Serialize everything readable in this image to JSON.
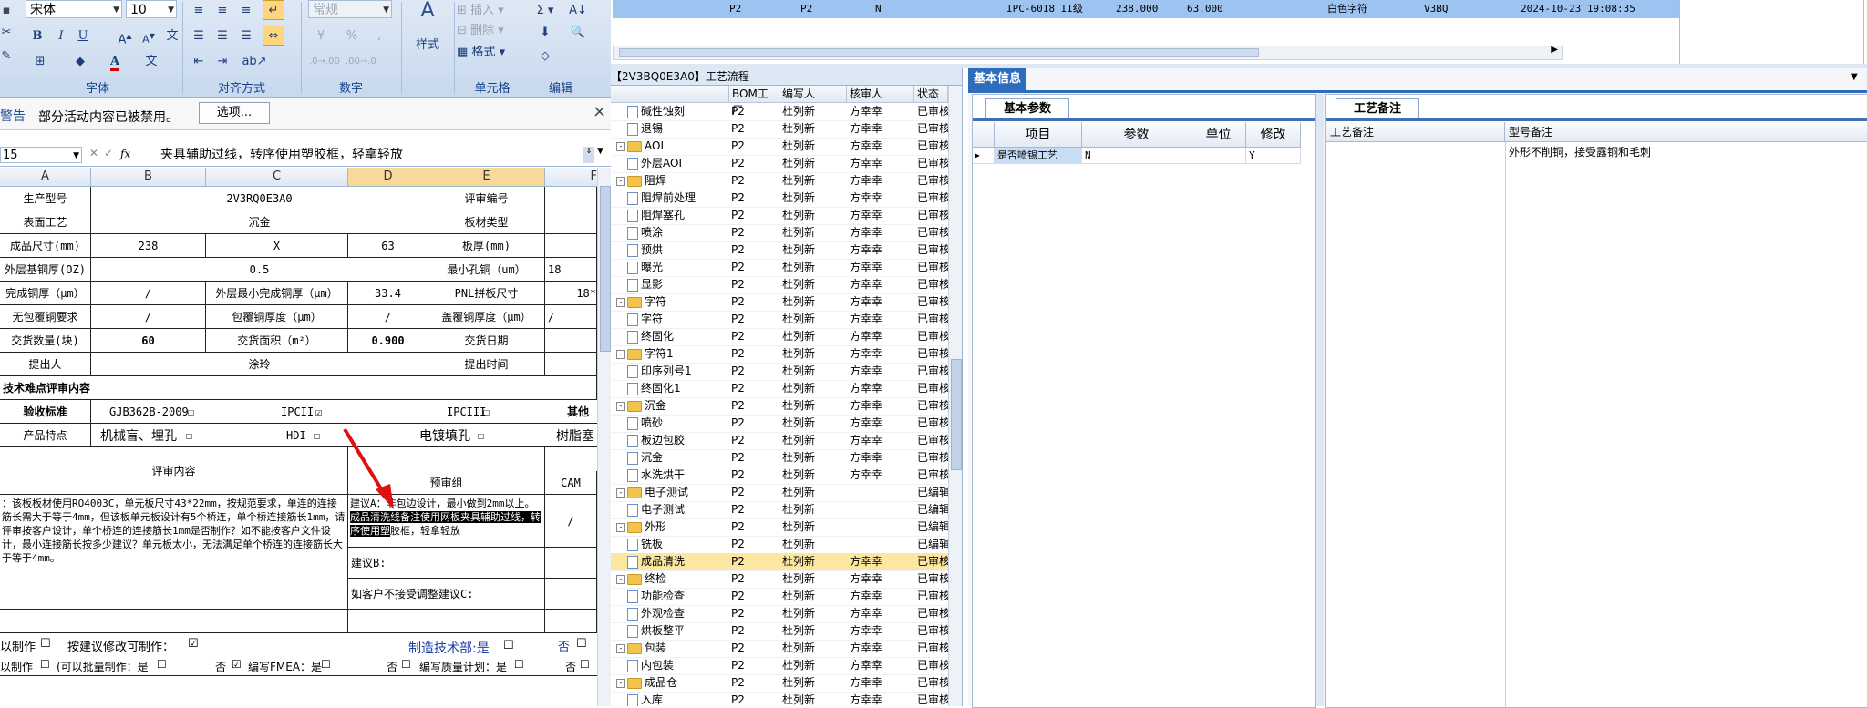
{
  "ribbon": {
    "font_name": "宋体",
    "font_size": "10",
    "number_format": "常规",
    "groups": [
      "字体",
      "对齐方式",
      "数字",
      "单元格",
      "编辑"
    ],
    "style_label": "样式",
    "insert_label": "插入",
    "delete_label": "删除",
    "format_label": "格式",
    "sigma": "Σ",
    "font_color": "#d40000"
  },
  "warning": {
    "title": "警告",
    "message": "部分活动内容已被禁用。",
    "options_button": "选项...",
    "close": "×"
  },
  "formula_bar": {
    "name_box": "15",
    "fx": "fx",
    "content": "夹具辅助过线，转序使用塑胶框，轻拿轻放"
  },
  "columns": [
    "A",
    "B",
    "C",
    "D",
    "E",
    "F"
  ],
  "sheet": {
    "r1": [
      "生产型号",
      "2V3RQ0E3A0",
      "评审编号",
      ""
    ],
    "r2": [
      "表面工艺",
      "沉金",
      "板材类型",
      ""
    ],
    "r3": [
      "成品尺寸(mm)",
      "238",
      "X",
      "63",
      "板厚(mm)",
      ""
    ],
    "r4": [
      "外层基铜厚(OZ)",
      "0.5",
      "最小孔铜（um）",
      "18"
    ],
    "r5": [
      "完成铜厚（μm）",
      "/",
      "外层最小完成铜厚（μm）",
      "33.4",
      "PNL拼板尺寸",
      "18*"
    ],
    "r6": [
      "无包覆铜要求",
      "/",
      "包覆铜厚度（μm）",
      "/",
      "盖覆铜厚度（μm）",
      "/"
    ],
    "r7": [
      "交货数量(块)",
      "60",
      "交货面积（m²）",
      "0.900",
      "交货日期",
      ""
    ],
    "r8": [
      "提出人",
      "涂玲",
      "提出时间",
      ""
    ],
    "section": "技术难点评审内容",
    "acc_label": "验收标准",
    "acc_opts": [
      "GJB362B-2009",
      "IPCII",
      "IPCIII",
      "其他"
    ],
    "feat_label": "产品特点",
    "feat_opts": [
      "机械盲、埋孔",
      "HDI",
      "电镀填孔",
      "树脂塞"
    ],
    "review_header": "评审内容",
    "pre_review": "预审组",
    "cam": "CAM",
    "review_text": "：该板板材使用RO4003C，单元板尺寸43*22mm，按规范要求，单连的连接筋长需大于等于4mm，但该板单元板设计有5个桥连，单个桥连接筋长1mm，请评审按客户设计，单个桥连的连接筋长1mm是否制作？如不能按客户文件设计，最小连接筋长按多少建议？单元板太小，无法满足单个桥连的连接筋长大于等于4mm。",
    "suggest_a_pre": "建议A：非包边设计，最小做到2mm以上。",
    "suggest_a_sel": "成品清洗线备注使用网板夹具辅助过线，转序使用塑",
    "suggest_a_post": "胶框，轻拿轻放",
    "suggest_b": "建议B:",
    "suggest_c": "如客户不接受调整建议C:",
    "slash": "/",
    "f1_left": "以制作",
    "f1_mid": "按建议修改可制作：",
    "f1_dept": "制造技术部:是",
    "f1_no": "否",
    "f2_left": "以制作",
    "f2_batch": "(可以批量制作：是",
    "f2_no": "否",
    "f2_fmea": "编写FMEA：是",
    "f2_no2": "否",
    "f2_plan": "编写质量计划：是",
    "f2_no3": "否"
  },
  "top_row": {
    "cells": [
      "P2",
      "P2",
      "N",
      "IPC-6018 II级",
      "238.000",
      "63.000",
      "白色字符",
      "V3BQ",
      "2024-10-23 19:08:35"
    ]
  },
  "tree": {
    "title": "【2V3BQ0E3A0】工艺流程",
    "headers": [
      "BOM工厂",
      "编写人",
      "核审人",
      "状态"
    ],
    "rows": [
      {
        "level": 1,
        "type": "doc",
        "name": "碱性蚀刻",
        "f": "P2",
        "w": "杜列新",
        "r": "方幸幸",
        "s": "已审核"
      },
      {
        "level": 1,
        "type": "doc",
        "name": "退锡",
        "f": "P2",
        "w": "杜列新",
        "r": "方幸幸",
        "s": "已审核"
      },
      {
        "level": 0,
        "type": "folder",
        "name": "AOI",
        "f": "P2",
        "w": "杜列新",
        "r": "方幸幸",
        "s": "已审核"
      },
      {
        "level": 1,
        "type": "doc",
        "name": "外层AOI",
        "f": "P2",
        "w": "杜列新",
        "r": "方幸幸",
        "s": "已审核"
      },
      {
        "level": 0,
        "type": "folder",
        "name": "阻焊",
        "f": "P2",
        "w": "杜列新",
        "r": "方幸幸",
        "s": "已审核"
      },
      {
        "level": 1,
        "type": "doc",
        "name": "阻焊前处理",
        "f": "P2",
        "w": "杜列新",
        "r": "方幸幸",
        "s": "已审核"
      },
      {
        "level": 1,
        "type": "doc",
        "name": "阻焊塞孔",
        "f": "P2",
        "w": "杜列新",
        "r": "方幸幸",
        "s": "已审核"
      },
      {
        "level": 1,
        "type": "doc",
        "name": "喷涂",
        "f": "P2",
        "w": "杜列新",
        "r": "方幸幸",
        "s": "已审核"
      },
      {
        "level": 1,
        "type": "doc",
        "name": "预烘",
        "f": "P2",
        "w": "杜列新",
        "r": "方幸幸",
        "s": "已审核"
      },
      {
        "level": 1,
        "type": "doc",
        "name": "曝光",
        "f": "P2",
        "w": "杜列新",
        "r": "方幸幸",
        "s": "已审核"
      },
      {
        "level": 1,
        "type": "doc",
        "name": "显影",
        "f": "P2",
        "w": "杜列新",
        "r": "方幸幸",
        "s": "已审核"
      },
      {
        "level": 0,
        "type": "folder",
        "name": "字符",
        "f": "P2",
        "w": "杜列新",
        "r": "方幸幸",
        "s": "已审核"
      },
      {
        "level": 1,
        "type": "doc",
        "name": "字符",
        "f": "P2",
        "w": "杜列新",
        "r": "方幸幸",
        "s": "已审核"
      },
      {
        "level": 1,
        "type": "doc",
        "name": "终固化",
        "f": "P2",
        "w": "杜列新",
        "r": "方幸幸",
        "s": "已审核"
      },
      {
        "level": 0,
        "type": "folder",
        "name": "字符1",
        "f": "P2",
        "w": "杜列新",
        "r": "方幸幸",
        "s": "已审核"
      },
      {
        "level": 1,
        "type": "doc",
        "name": "印序列号1",
        "f": "P2",
        "w": "杜列新",
        "r": "方幸幸",
        "s": "已审核"
      },
      {
        "level": 1,
        "type": "doc",
        "name": "终固化1",
        "f": "P2",
        "w": "杜列新",
        "r": "方幸幸",
        "s": "已审核"
      },
      {
        "level": 0,
        "type": "folder",
        "name": "沉金",
        "f": "P2",
        "w": "杜列新",
        "r": "方幸幸",
        "s": "已审核"
      },
      {
        "level": 1,
        "type": "doc",
        "name": "喷砂",
        "f": "P2",
        "w": "杜列新",
        "r": "方幸幸",
        "s": "已审核"
      },
      {
        "level": 1,
        "type": "doc",
        "name": "板边包胶",
        "f": "P2",
        "w": "杜列新",
        "r": "方幸幸",
        "s": "已审核"
      },
      {
        "level": 1,
        "type": "doc",
        "name": "沉金",
        "f": "P2",
        "w": "杜列新",
        "r": "方幸幸",
        "s": "已审核"
      },
      {
        "level": 1,
        "type": "doc",
        "name": "水洗烘干",
        "f": "P2",
        "w": "杜列新",
        "r": "方幸幸",
        "s": "已审核"
      },
      {
        "level": 0,
        "type": "folder",
        "name": "电子测试",
        "f": "P2",
        "w": "杜列新",
        "r": "",
        "s": "已编辑"
      },
      {
        "level": 1,
        "type": "doc",
        "name": "电子测试",
        "f": "P2",
        "w": "杜列新",
        "r": "",
        "s": "已编辑"
      },
      {
        "level": 0,
        "type": "folder",
        "name": "外形",
        "f": "P2",
        "w": "杜列新",
        "r": "",
        "s": "已编辑"
      },
      {
        "level": 1,
        "type": "doc",
        "name": "铣板",
        "f": "P2",
        "w": "杜列新",
        "r": "",
        "s": "已编辑"
      },
      {
        "level": 1,
        "type": "doc",
        "name": "成品清洗",
        "f": "P2",
        "w": "杜列新",
        "r": "方幸幸",
        "s": "已审核"
      },
      {
        "level": 0,
        "type": "folder",
        "name": "终检",
        "f": "P2",
        "w": "杜列新",
        "r": "方幸幸",
        "s": "已审核"
      },
      {
        "level": 1,
        "type": "doc",
        "name": "功能检查",
        "f": "P2",
        "w": "杜列新",
        "r": "方幸幸",
        "s": "已审核"
      },
      {
        "level": 1,
        "type": "doc",
        "name": "外观检查",
        "f": "P2",
        "w": "杜列新",
        "r": "方幸幸",
        "s": "已审核"
      },
      {
        "level": 1,
        "type": "doc",
        "name": "烘板整平",
        "f": "P2",
        "w": "杜列新",
        "r": "方幸幸",
        "s": "已审核"
      },
      {
        "level": 0,
        "type": "folder",
        "name": "包装",
        "f": "P2",
        "w": "杜列新",
        "r": "方幸幸",
        "s": "已审核"
      },
      {
        "level": 1,
        "type": "doc",
        "name": "内包装",
        "f": "P2",
        "w": "杜列新",
        "r": "方幸幸",
        "s": "已审核"
      },
      {
        "level": 0,
        "type": "folder",
        "name": "成品仓",
        "f": "P2",
        "w": "杜列新",
        "r": "方幸幸",
        "s": "已审核"
      },
      {
        "level": 1,
        "type": "doc",
        "name": "入库",
        "f": "P2",
        "w": "杜列新",
        "r": "方幸幸",
        "s": "已审核"
      }
    ]
  },
  "right_panel": {
    "main_tab": "基本信息",
    "sub_tab1": "基本参数",
    "sub_tab2": "工艺备注",
    "param_headers": [
      "项目",
      "参数",
      "单位",
      "修改"
    ],
    "param_row": [
      "是否喷锡工艺",
      "N",
      "",
      "Y"
    ],
    "remark_headers": [
      "工艺备注",
      "型号备注"
    ],
    "remark_value": "外形不削铜，接受露铜和毛刺"
  }
}
